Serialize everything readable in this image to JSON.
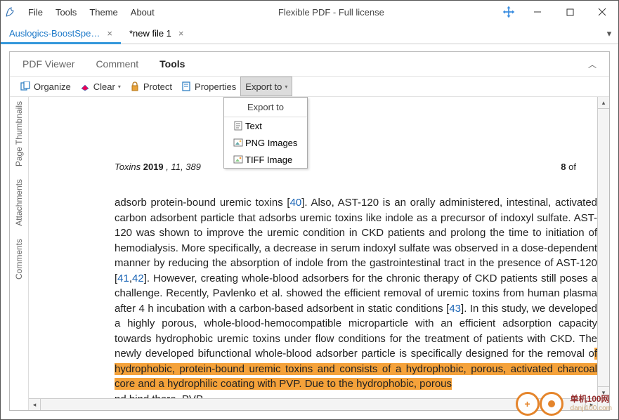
{
  "window": {
    "title": "Flexible PDF - Full license",
    "menu": [
      "File",
      "Tools",
      "Theme",
      "About"
    ]
  },
  "doc_tabs": [
    {
      "label": "Auslogics-BoostSpe…",
      "active": true
    },
    {
      "label": "*new file 1",
      "active": false
    }
  ],
  "ribbon": {
    "tabs": [
      "PDF Viewer",
      "Comment",
      "Tools"
    ],
    "active": "Tools"
  },
  "toolbar": {
    "organize": "Organize",
    "clear": "Clear",
    "protect": "Protect",
    "properties": "Properties",
    "export": "Export to"
  },
  "export_menu": {
    "header": "Export to",
    "items": [
      "Text",
      "PNG Images",
      "TIFF Image"
    ]
  },
  "side_tabs": [
    "Page Thumbnails",
    "Attachments",
    "Comments"
  ],
  "page": {
    "journal": "Toxins",
    "year_bold": "2019",
    "issue": ", 11, 389",
    "page_num": "8",
    "page_of": " of",
    "body_pre": "adsorb protein-bound uremic toxins [",
    "cite1": "40",
    "body_1": "].  Also, AST-120 is an orally administered, intestinal, activated carbon adsorbent particle that adsorbs uremic toxins like indole as a precursor of indoxyl sulfate. AST-120 was shown to improve the uremic condition in CKD patients and prolong the time to initiation of hemodialysis.  More specifically, a decrease in serum indoxyl sulfate was observed in a dose-dependent manner by reducing the absorption of indole from the gastrointestinal tract in the presence of AST-120 [",
    "cite2": "41",
    "cite_comma": ",",
    "cite3": "42",
    "body_2": "].  However, creating whole-blood adsorbers for the chronic therapy of CKD patients still poses a challenge.  Recently, Pavlenko et al.  showed the efficient removal of uremic toxins from human plasma after 4 h incubation with a carbon-based adsorbent in static conditions [",
    "cite4": "43",
    "body_3": "].  In this study, we developed a highly porous, whole-blood-hemocompatible microparticle with an efficient adsorption capacity towards hydrophobic uremic toxins under flow conditions for the treatment of patients with CKD.  The newly developed bifunctional whole-blood adsorber particle is specifically designed for the removal o",
    "hl1": "f hydrophobic, protein-bound uremic toxins and consists of a hydrophobic, porous, activated charcoal core and a hydrophilic coating with PVP.  Due to the hydrophobic, porous",
    "body_4_tail": "nd bind there.  PVP,",
    "hl2_overlay": "                                                                                                                       "
  },
  "watermark": {
    "cn": "单机100网",
    "en": "danji100.com"
  }
}
